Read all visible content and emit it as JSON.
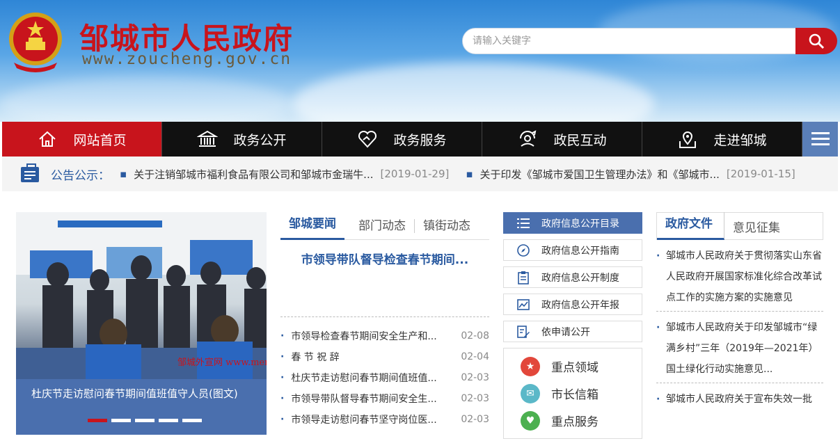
{
  "header": {
    "title": "邹城市人民政府",
    "url": "www.zoucheng.gov.cn",
    "search_placeholder": "请输入关键字",
    "emblem_icon": "national-emblem-icon"
  },
  "nav": {
    "items": [
      {
        "label": "网站首页",
        "icon": "home-icon"
      },
      {
        "label": "政务公开",
        "icon": "government-building-icon"
      },
      {
        "label": "政务服务",
        "icon": "handshake-heart-icon"
      },
      {
        "label": "政民互动",
        "icon": "chat-people-icon"
      },
      {
        "label": "走进邹城",
        "icon": "map-pin-icon"
      }
    ],
    "menu_icon": "hamburger-menu-icon"
  },
  "notice": {
    "label": "公告公示：",
    "items": [
      {
        "text": "关于注销邹城市福利食品有限公司和邹城市金瑞牛...",
        "date": "[2019-01-29]"
      },
      {
        "text": "关于印发《邹城市爱国卫生管理办法》和《邹城市...",
        "date": "[2019-01-15]"
      }
    ]
  },
  "slide": {
    "caption": "杜庆节走访慰问春节期间值班值守人员(图文)",
    "watermark": "邹城外宣网 www.mencius.gov.cn"
  },
  "news": {
    "tabs": [
      "邹城要闻",
      "部门动态",
      "镇街动态"
    ],
    "headline": "市领导带队督导检查春节期间...",
    "rows": [
      {
        "title": "市领导检查春节期间安全生产和...",
        "date": "02-08"
      },
      {
        "title": "春 节 祝 辞",
        "date": "02-04"
      },
      {
        "title": "杜庆节走访慰问春节期间值班值...",
        "date": "02-03"
      },
      {
        "title": "市领导带队督导春节期间安全生...",
        "date": "02-03"
      },
      {
        "title": "市领导走访慰问春节坚守岗位医...",
        "date": "02-03"
      }
    ]
  },
  "info": {
    "buttons": [
      {
        "label": "政府信息公开目录",
        "icon": "list-icon"
      },
      {
        "label": "政府信息公开指南",
        "icon": "compass-icon"
      },
      {
        "label": "政府信息公开制度",
        "icon": "clipboard-icon"
      },
      {
        "label": "政府信息公开年报",
        "icon": "chart-icon"
      },
      {
        "label": "依申请公开",
        "icon": "edit-document-icon"
      }
    ],
    "key": [
      {
        "label": "重点领域",
        "icon": "star-icon",
        "color": "#e2473b"
      },
      {
        "label": "市长信箱",
        "icon": "mail-icon",
        "color": "#5bb8c8"
      },
      {
        "label": "重点服务",
        "icon": "heart-hand-icon",
        "color": "#4cb050"
      }
    ]
  },
  "docs": {
    "tabs": [
      "政府文件",
      "意见征集"
    ],
    "items": [
      "邹城市人民政府关于贯彻落实山东省人民政府开展国家标准化综合改革试点工作的实施方案的实施意见",
      "邹城市人民政府关于印发邹城市“绿满乡村”三年（2019年—2021年）国土绿化行动实施意见...",
      "邹城市人民政府关于宣布失效一批"
    ]
  },
  "colors": {
    "brand_red": "#c8141c",
    "nav_blue": "#4a6fae",
    "link_blue": "#2a5aa0"
  }
}
